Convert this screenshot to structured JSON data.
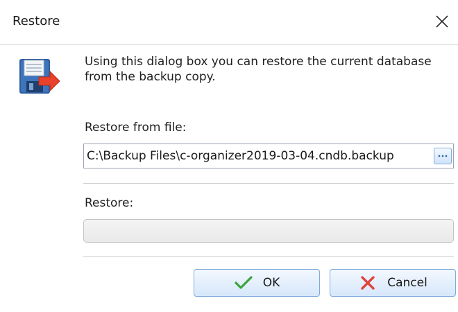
{
  "window": {
    "title": "Restore",
    "close_icon": "close-icon"
  },
  "dialog": {
    "icon": "restore-database-icon",
    "description": "Using this dialog box you can restore the current database from the backup copy.",
    "file_label": "Restore from file:",
    "file_value": "C:\\Backup Files\\c-organizer2019-03-04.cndb.backup",
    "browse_icon": "ellipsis-icon",
    "progress_label": "Restore:",
    "progress_value": 0
  },
  "buttons": {
    "ok_label": "OK",
    "ok_icon": "checkmark-icon",
    "cancel_label": "Cancel",
    "cancel_icon": "x-icon"
  },
  "colors": {
    "button_border": "#7fa9d9",
    "ok_check": "#3aa43a",
    "cancel_x": "#e0443a",
    "icon_arrow": "#e8412c",
    "icon_disk": "#2f5e9e"
  }
}
